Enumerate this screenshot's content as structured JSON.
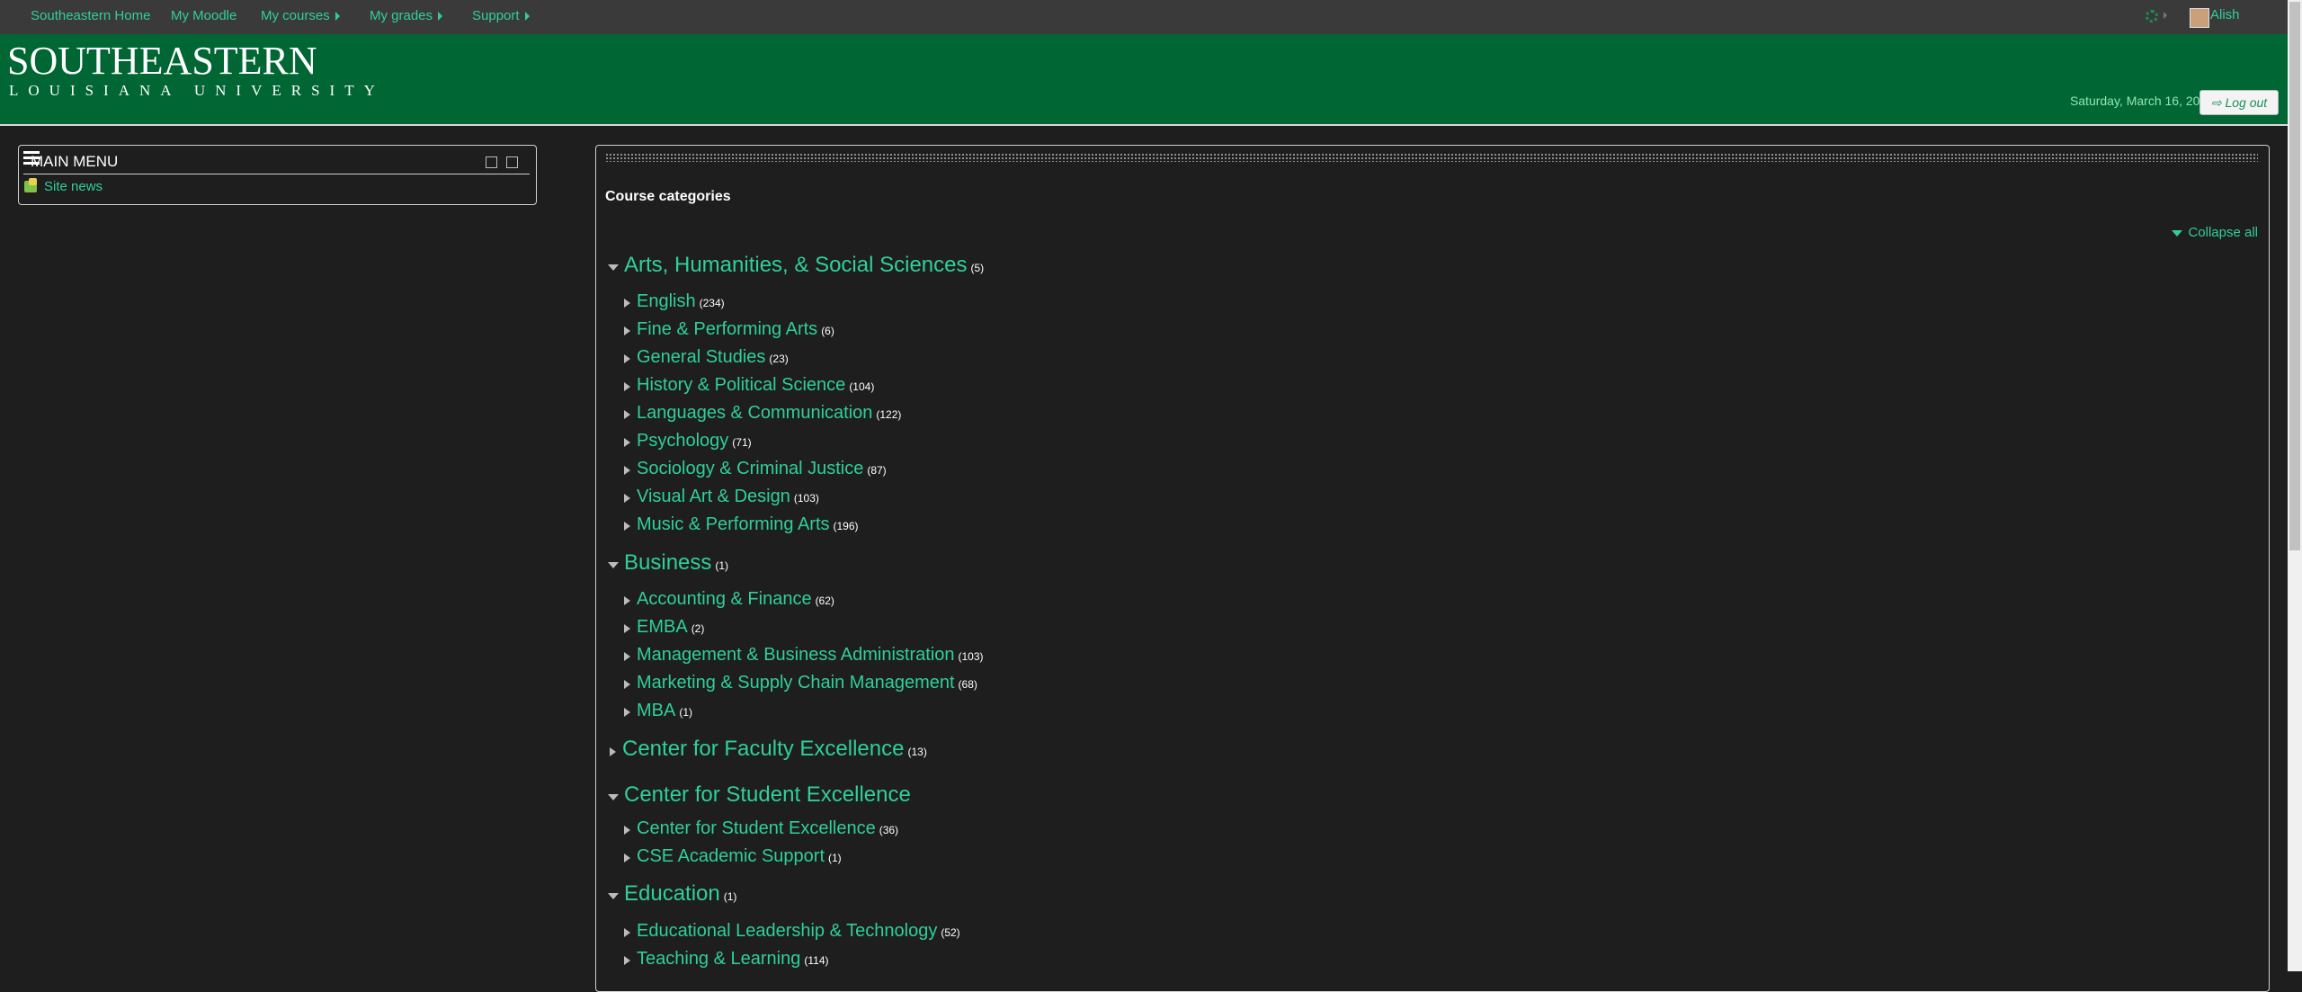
{
  "topnav": {
    "items": [
      "Southeastern Home",
      "My Moodle",
      "My courses",
      "My grades",
      "Support"
    ],
    "user": "Alish"
  },
  "header": {
    "logo_main": "SOUTHEASTERN",
    "logo_sub": "LOUISIANA UNIVERSITY",
    "date": "Saturday, March 16, 2019",
    "logout": "Log out"
  },
  "sidebar": {
    "title": "MAIN MENU",
    "site_news": "Site news"
  },
  "main": {
    "title": "Course categories",
    "collapse_all": "Collapse all",
    "categories": [
      {
        "name": "Arts, Humanities, & Social Sciences",
        "count": "(5)",
        "expanded": true,
        "children": [
          {
            "name": "English",
            "count": "(234)"
          },
          {
            "name": "Fine & Performing Arts",
            "count": "(6)"
          },
          {
            "name": "General Studies",
            "count": "(23)"
          },
          {
            "name": "History & Political Science",
            "count": "(104)"
          },
          {
            "name": "Languages & Communication",
            "count": "(122)"
          },
          {
            "name": "Psychology",
            "count": "(71)"
          },
          {
            "name": "Sociology & Criminal Justice",
            "count": "(87)"
          },
          {
            "name": "Visual Art & Design",
            "count": "(103)"
          },
          {
            "name": "Music & Performing Arts",
            "count": "(196)"
          }
        ]
      },
      {
        "name": "Business",
        "count": "(1)",
        "expanded": true,
        "children": [
          {
            "name": "Accounting & Finance",
            "count": "(62)"
          },
          {
            "name": "EMBA",
            "count": "(2)"
          },
          {
            "name": "Management & Business Administration",
            "count": "(103)"
          },
          {
            "name": "Marketing & Supply Chain Management",
            "count": "(68)"
          },
          {
            "name": "MBA",
            "count": "(1)"
          }
        ]
      },
      {
        "name": "Center for Faculty Excellence",
        "count": "(13)",
        "expanded": false,
        "children": []
      },
      {
        "name": "Center for Student Excellence",
        "count": "",
        "expanded": true,
        "children": [
          {
            "name": "Center for Student Excellence",
            "count": "(36)"
          },
          {
            "name": "CSE Academic Support",
            "count": "(1)"
          }
        ]
      },
      {
        "name": "Education",
        "count": "(1)",
        "expanded": true,
        "children": [
          {
            "name": "Educational Leadership & Technology",
            "count": "(52)"
          },
          {
            "name": "Teaching & Learning",
            "count": "(114)"
          }
        ]
      }
    ]
  },
  "colors": {
    "accent": "#2fcf9a",
    "header_green": "#006633",
    "background": "#1e1e1f",
    "topbar": "#3a3a3a"
  }
}
